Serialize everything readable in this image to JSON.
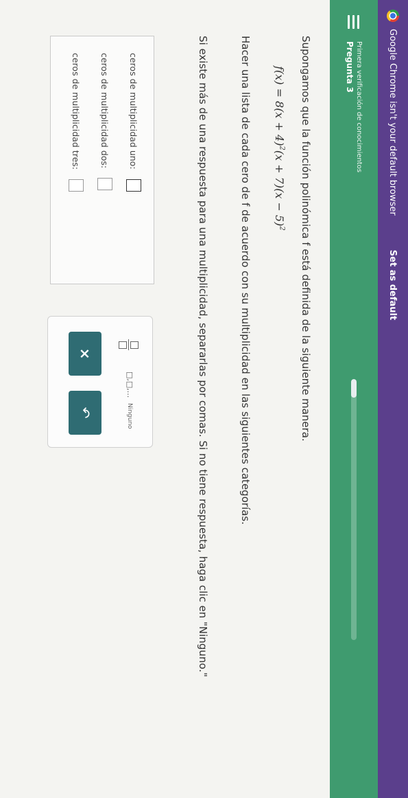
{
  "chrome_bar": {
    "message": "Google Chrome isn't your default browser",
    "action_label": "Set as default"
  },
  "header": {
    "subtitle": "Primera verificación de conocimientos",
    "title": "Pregunta 3",
    "progress_fraction": 0.07
  },
  "question": {
    "intro": "Supongamos que la función polinómica f está definida de la siguiente manera.",
    "formula": {
      "lhs": "f(x) = 8",
      "factor1": "(x + 4)",
      "exp1": "2",
      "factor2": "(x + 7)",
      "factor3": "(x − 5)",
      "exp3": "2"
    },
    "instruction": "Hacer una lista de cada cero de f de acuerdo con su multiplicidad en las siguientes categorías.",
    "note": "Si existe más de una respuesta para una multiplicidad, separarlas por comas. Si no tiene respuesta, haga clic en \"Ninguno.\""
  },
  "answers": [
    {
      "label": "ceros de multiplicidad uno:",
      "value": ""
    },
    {
      "label": "ceros de multiplicidad dos:",
      "value": ""
    },
    {
      "label": "ceros de multiplicidad tres:",
      "value": ""
    }
  ],
  "tools": {
    "list_symbol": "□,□,...",
    "none_label": "Ninguno",
    "clear_symbol": "×",
    "undo_symbol": "↶"
  },
  "colors": {
    "chrome_bar": "#5b3f8c",
    "header": "#3f9b6f",
    "button": "#2f6c73"
  }
}
